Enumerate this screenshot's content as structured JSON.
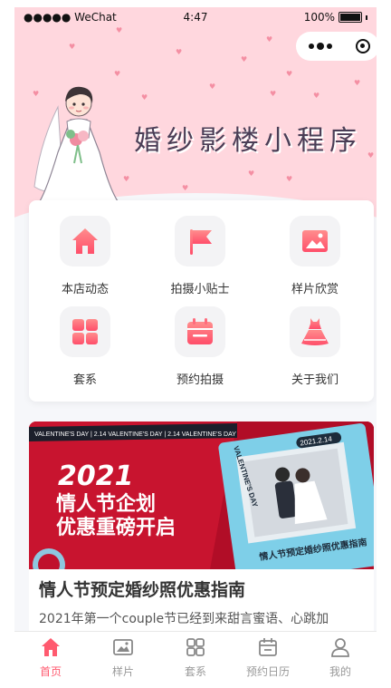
{
  "status_bar": {
    "carrier": "●●●●● WeChat",
    "time": "4:47",
    "battery": "100%"
  },
  "header": {
    "title": "婚纱影楼小程序"
  },
  "menu": [
    {
      "label": "本店动态",
      "icon": "home-icon"
    },
    {
      "label": "拍摄小贴士",
      "icon": "flag-icon"
    },
    {
      "label": "样片欣赏",
      "icon": "picture-icon"
    },
    {
      "label": "套系",
      "icon": "grid-icon"
    },
    {
      "label": "预约拍摄",
      "icon": "calendar-icon"
    },
    {
      "label": "关于我们",
      "icon": "dress-icon"
    }
  ],
  "banner": {
    "ticker": "VALENTINE'S DAY | 2.14 VALENTINE'S DAY | 2.14 VALENTINE'S DAY",
    "year": "2021",
    "line1": "情人节企划",
    "line2": "优惠重磅开启",
    "card_date": "2021.2.14",
    "card_side": "VALENTINE'S DAY",
    "card_caption": "情人节预定婚纱照优惠指南"
  },
  "article": {
    "title": "情人节预定婚纱照优惠指南",
    "excerpt": "2021年第一个couple节已经到来甜言蜜语、心跳加"
  },
  "tabbar": [
    {
      "label": "首页",
      "icon": "home-tab-icon",
      "active": true
    },
    {
      "label": "样片",
      "icon": "image-tab-icon",
      "active": false
    },
    {
      "label": "套系",
      "icon": "grid-tab-icon",
      "active": false
    },
    {
      "label": "预约日历",
      "icon": "calendar-tab-icon",
      "active": false
    },
    {
      "label": "我的",
      "icon": "user-tab-icon",
      "active": false
    }
  ],
  "colors": {
    "accent": "#ff5a6f",
    "header_bg": "#ffd7de",
    "banner_bg": "#c0102c"
  }
}
